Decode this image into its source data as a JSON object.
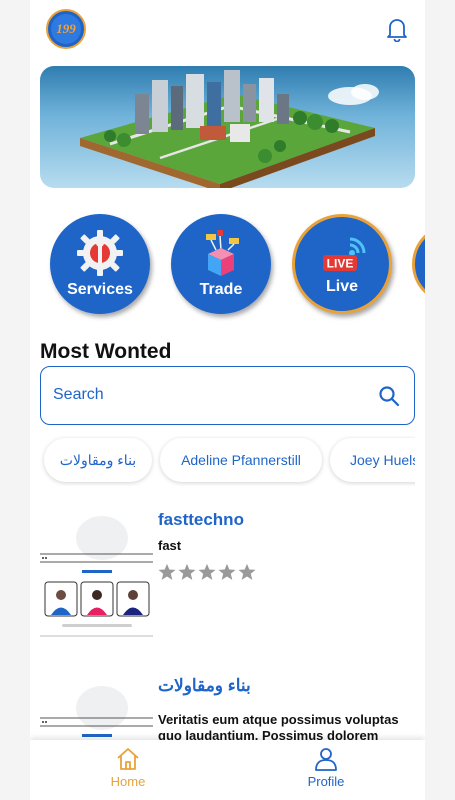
{
  "header": {
    "logo_text": "199",
    "bell_icon": "bell-icon"
  },
  "categories": [
    {
      "label": "Services",
      "icon": "gear-wrench-icon"
    },
    {
      "label": "Trade",
      "icon": "trade-box-icon"
    },
    {
      "label": "Live",
      "icon": "live-broadcast-icon",
      "badge": "LIVE"
    }
  ],
  "section": {
    "title": "Most Wonted"
  },
  "search": {
    "placeholder": "Search",
    "icon": "search-icon"
  },
  "chips": [
    "بناء ومقاولات",
    "Adeline Pfannerstill",
    "Joey Huels"
  ],
  "listings": [
    {
      "title": "fasttechno",
      "subtitle": "fast",
      "rating": 0,
      "stars_max": 5
    },
    {
      "title": "بناء ومقاولات",
      "description": "Veritatis eum atque possimus voluptas quo laudantium. Possimus dolorem"
    }
  ],
  "nav": {
    "home_label": "Home",
    "profile_label": "Profile"
  },
  "colors": {
    "primary": "#1f65c8",
    "accent": "#e9a23a",
    "star_inactive": "#9a9a9a"
  }
}
